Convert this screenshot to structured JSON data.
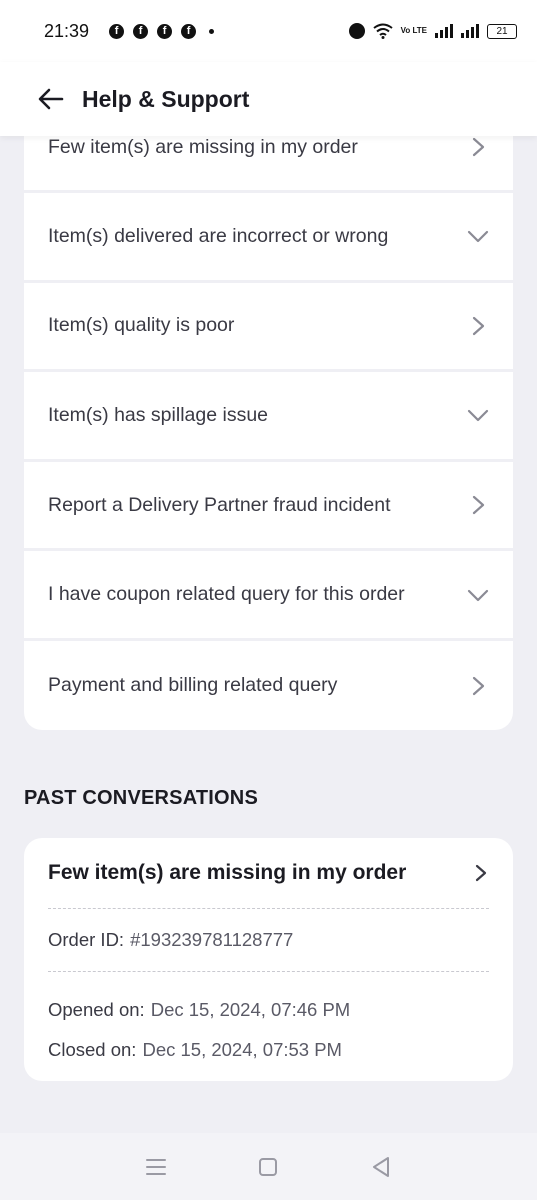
{
  "status_bar": {
    "time": "21:39",
    "notification_icons": [
      "facebook-icon",
      "facebook-icon",
      "facebook-icon",
      "facebook-icon"
    ],
    "volte_label": "Vo LTE",
    "battery": "21"
  },
  "header": {
    "title": "Help & Support",
    "back_icon": "arrow-left-icon"
  },
  "issues": [
    {
      "label": "Few item(s) are missing in my order",
      "icon": "chevron-right-icon"
    },
    {
      "label": "Item(s) delivered are incorrect or wrong",
      "icon": "chevron-down-icon"
    },
    {
      "label": "Item(s) quality is poor",
      "icon": "chevron-right-icon"
    },
    {
      "label": "Item(s) has spillage issue",
      "icon": "chevron-down-icon"
    },
    {
      "label": "Report a Delivery Partner fraud incident",
      "icon": "chevron-right-icon"
    },
    {
      "label": "I have coupon related query for this order",
      "icon": "chevron-down-icon"
    },
    {
      "label": "Payment and billing related query",
      "icon": "chevron-right-icon"
    }
  ],
  "past_conversations": {
    "heading": "PAST CONVERSATIONS",
    "items": [
      {
        "title": "Few item(s) are missing in my order",
        "order_id_label": "Order ID:",
        "order_id": "#193239781128777",
        "opened_label": "Opened on:",
        "opened_value": "Dec 15, 2024, 07:46 PM",
        "closed_label": "Closed on:",
        "closed_value": "Dec 15, 2024, 07:53 PM"
      }
    ]
  },
  "nav_bar": {
    "icons": [
      "menu-icon",
      "home-square-icon",
      "back-triangle-icon"
    ]
  },
  "colors": {
    "background": "#efeff4",
    "card": "#ffffff",
    "text_primary": "#1b1b22",
    "chevron": "#8a8a94"
  }
}
